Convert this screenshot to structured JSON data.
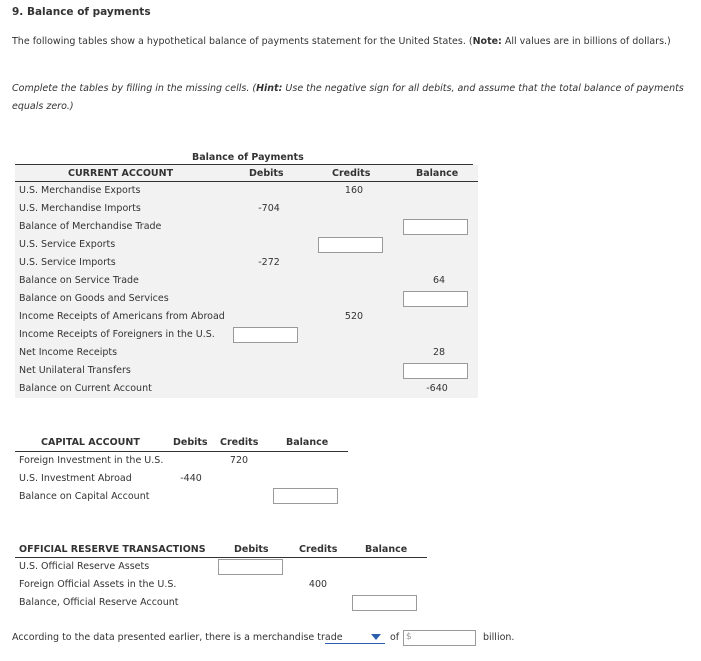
{
  "question": {
    "title": "9. Balance of payments",
    "description": "The following tables show a hypothetical balance of payments statement for the United States. (",
    "note_label": "Note:",
    "note_text": " All values are in billions of dollars.)",
    "instruction_prefix": "Complete the tables by filling in the missing cells. (",
    "hint_label": "Hint:",
    "instruction_suffix": " Use the negative sign for all debits, and assume that the total balance of payments equals zero.)"
  },
  "current_account": {
    "caption": "Balance of Payments",
    "headers": {
      "section": "CURRENT ACCOUNT",
      "debits": "Debits",
      "credits": "Credits",
      "balance": "Balance"
    },
    "rows": [
      {
        "label": "U.S. Merchandise Exports",
        "debits": "",
        "credits": "160",
        "balance": ""
      },
      {
        "label": "U.S. Merchandise Imports",
        "debits": "-704",
        "credits": "",
        "balance": ""
      },
      {
        "label": "Balance of Merchandise Trade",
        "debits": "",
        "credits": "",
        "balance": ""
      },
      {
        "label": "U.S. Service Exports",
        "debits": "",
        "credits": "",
        "balance": ""
      },
      {
        "label": "U.S. Service Imports",
        "debits": "-272",
        "credits": "",
        "balance": ""
      },
      {
        "label": "Balance on Service Trade",
        "debits": "",
        "credits": "",
        "balance": "64"
      },
      {
        "label": "Balance on Goods and Services",
        "debits": "",
        "credits": "",
        "balance": ""
      },
      {
        "label": "Income Receipts of Americans from Abroad",
        "debits": "",
        "credits": "520",
        "balance": ""
      },
      {
        "label": "Income Receipts of Foreigners in the U.S.",
        "debits": "",
        "credits": "",
        "balance": ""
      },
      {
        "label": "Net Income Receipts",
        "debits": "",
        "credits": "",
        "balance": "28"
      },
      {
        "label": "Net Unilateral Transfers",
        "debits": "",
        "credits": "",
        "balance": ""
      },
      {
        "label": "Balance on Current Account",
        "debits": "",
        "credits": "",
        "balance": "-640"
      }
    ]
  },
  "capital_account": {
    "headers": {
      "section": "CAPITAL ACCOUNT",
      "debits": "Debits",
      "credits": "Credits",
      "balance": "Balance"
    },
    "rows": [
      {
        "label": "Foreign Investment in the U.S.",
        "debits": "",
        "credits": "720",
        "balance": ""
      },
      {
        "label": "U.S. Investment Abroad",
        "debits": "-440",
        "credits": "",
        "balance": ""
      },
      {
        "label": "Balance on Capital Account",
        "debits": "",
        "credits": "",
        "balance": ""
      }
    ]
  },
  "official_reserve": {
    "headers": {
      "section": "OFFICIAL RESERVE TRANSACTIONS",
      "debits": "Debits",
      "credits": "Credits",
      "balance": "Balance"
    },
    "rows": [
      {
        "label": "U.S. Official Reserve Assets",
        "debits": "",
        "credits": "",
        "balance": ""
      },
      {
        "label": "Foreign Official Assets in the U.S.",
        "debits": "",
        "credits": "400",
        "balance": ""
      },
      {
        "label": "Balance, Official Reserve Account",
        "debits": "",
        "credits": "",
        "balance": ""
      }
    ]
  },
  "conclusion": {
    "prefix": "According to the data presented earlier, there is a merchandise trade",
    "dropdown_value": "",
    "of_label": "of",
    "currency_symbol": "$",
    "amount_value": "",
    "suffix": "billion."
  },
  "colors": {
    "row_shade": "#f2f2f2",
    "dropdown_accent": "#2b5fad"
  }
}
